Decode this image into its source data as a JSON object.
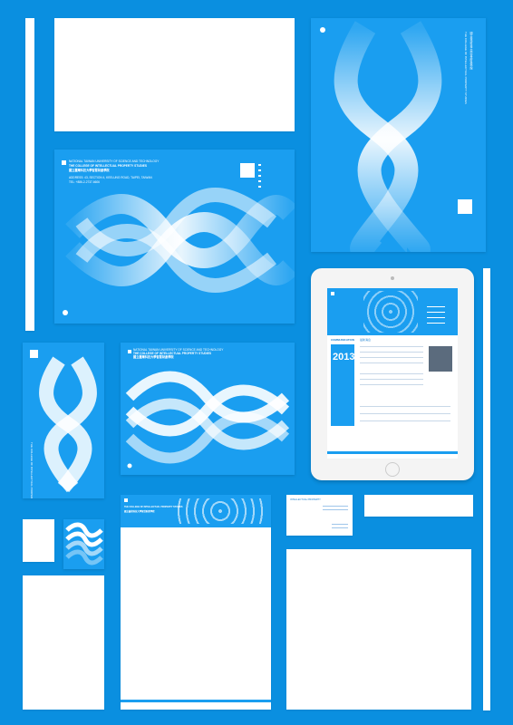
{
  "envelope_large": {
    "org_en": "NATIONAL TAIWAN UNIVERSITY OF SCIENCE AND TECHNOLOGY",
    "college_en": "THE COLLEGE OF INTELLECTUAL PROPERTY STUDIES",
    "college_zh": "國立臺灣科技大學智慧財產學院",
    "address": "ADDRESS: 43, SECTION 4, KEELUNG ROAD, TAIPEI, TAIWAN",
    "tel": "TEL: +886-2-2737-6606"
  },
  "envelope_medium": {
    "org_en": "NATIONAL TAIWAN UNIVERSITY OF SCIENCE AND TECHNOLOGY",
    "college_en": "THE COLLEGE OF INTELLECTUAL PROPERTY STUDIES",
    "college_zh": "國立臺灣科技大學智慧財產學院"
  },
  "tablet": {
    "year": "2013",
    "section_heading": "COMMUNICATION",
    "section_sub": "最新消息"
  },
  "letterhead": {
    "college_en": "THE COLLEGE OF INTELLECTUAL PROPERTY STUDIES",
    "college_zh": "國立臺灣科技大學智慧財產學院"
  },
  "business_card": {
    "college_en": "INTELLECTUAL PROPERTY"
  },
  "colors": {
    "background": "#0a8fe0",
    "brand_blue": "#1a9ef0",
    "paper": "#ffffff"
  },
  "icons": [
    "knot-graphic",
    "logo-mark"
  ]
}
